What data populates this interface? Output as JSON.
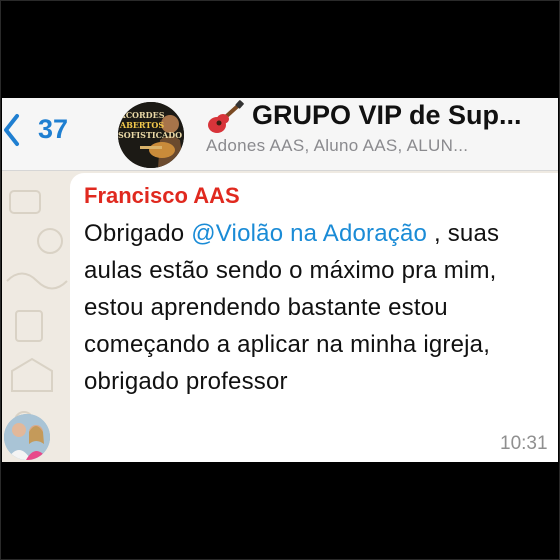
{
  "header": {
    "back_count": "37",
    "avatar_text": [
      "ACORDES",
      "ABERTOS",
      "SOFISTICADO"
    ],
    "group_title": "GRUPO VIP de Sup...",
    "participants": "Adones AAS, Aluno AAS, ALUN..."
  },
  "message": {
    "sender": "Francisco AAS",
    "text_before": "Obrigado ",
    "mention": "@Violão na Adoração",
    "text_after": " , suas aulas estão sendo o máximo pra mim, estou aprendendo bastante estou começando a aplicar na minha igreja, obrigado professor",
    "time": "10:31"
  },
  "colors": {
    "accent": "#1f7fd1",
    "sender": "#e0291f",
    "mention": "#1a8bd6",
    "chat_background": "#efeae2"
  },
  "icons": [
    "back-chevron-icon",
    "guitar-emoji-icon"
  ]
}
